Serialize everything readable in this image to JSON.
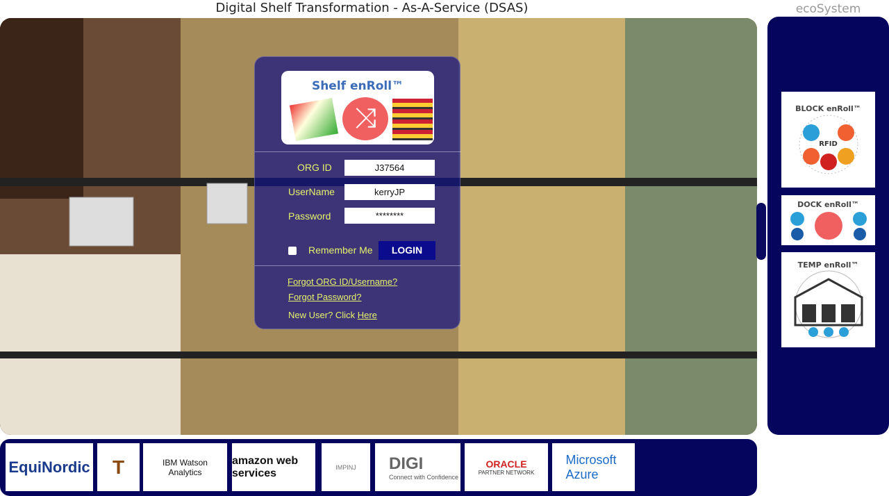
{
  "header": {
    "title": "Digital Shelf Transformation - As-A-Service (DSAS)",
    "ecosystem_title": "ecoSystem"
  },
  "login": {
    "logo_title": "Shelf enRoll™",
    "org_label": "ORG ID",
    "org_value": "J37564",
    "user_label": "UserName",
    "user_value": "kerryJP",
    "password_label": "Password",
    "password_value": "********",
    "remember_label": "Remember Me",
    "login_button": "LOGIN",
    "forgot_org": "Forgot ORG ID/Username?",
    "forgot_password": "Forgot Password?",
    "new_user_text": "New User? Click",
    "here_link": "Here"
  },
  "ecosystem": {
    "items": [
      {
        "label": "BLOCK enRoll™",
        "sub": "RFID"
      },
      {
        "label": "DOCK enRoll™"
      },
      {
        "label": "TEMP enRoll™"
      }
    ]
  },
  "partners": [
    {
      "name": "EquiNordic"
    },
    {
      "name": "T"
    },
    {
      "name": "IBM Watson Analytics"
    },
    {
      "name": "amazon web services"
    },
    {
      "name": "IMPINJ"
    },
    {
      "name": "DIGI",
      "sub": "Connect with Confidence"
    },
    {
      "name": "ORACLE",
      "sub": "PARTNER NETWORK"
    },
    {
      "name": "Microsoft Azure"
    }
  ]
}
